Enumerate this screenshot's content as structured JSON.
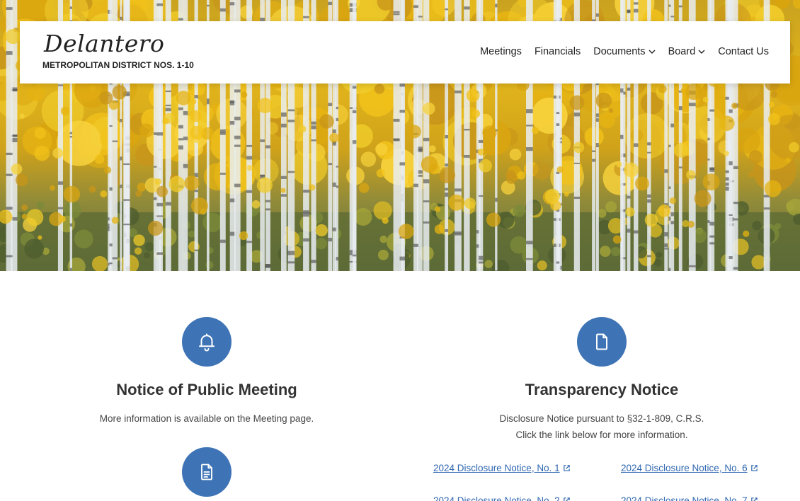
{
  "header": {
    "logo_title": "Delantero",
    "logo_subtitle": "METROPOLITAN DISTRICT NOS. 1-10"
  },
  "nav": {
    "items": [
      {
        "label": "Meetings",
        "has_dropdown": false
      },
      {
        "label": "Financials",
        "has_dropdown": false
      },
      {
        "label": "Documents",
        "has_dropdown": true
      },
      {
        "label": "Board",
        "has_dropdown": true
      },
      {
        "label": "Contact Us",
        "has_dropdown": false
      }
    ]
  },
  "hero": {
    "image": "aspen-forest-autumn-banner"
  },
  "notices": {
    "public_meeting": {
      "icon": "bell-icon",
      "title": "Notice of Public Meeting",
      "text": "More information is available on the Meeting page."
    },
    "transparency": {
      "icon": "document-icon",
      "title": "Transparency Notice",
      "text_line1": "Disclosure Notice pursuant to §32-1-809, C.R.S.",
      "text_line2": "Click the link below for more information."
    },
    "third": {
      "icon": "file-text-icon"
    }
  },
  "disclosure_links": [
    "2024 Disclosure Notice, No. 1",
    "2024 Disclosure Notice, No. 6",
    "2024 Disclosure Notice, No. 2",
    "2024 Disclosure Notice, No. 7"
  ],
  "colors": {
    "accent_blue": "#3e74b6",
    "link_blue": "#2f67b0",
    "text_dark": "#333333"
  }
}
